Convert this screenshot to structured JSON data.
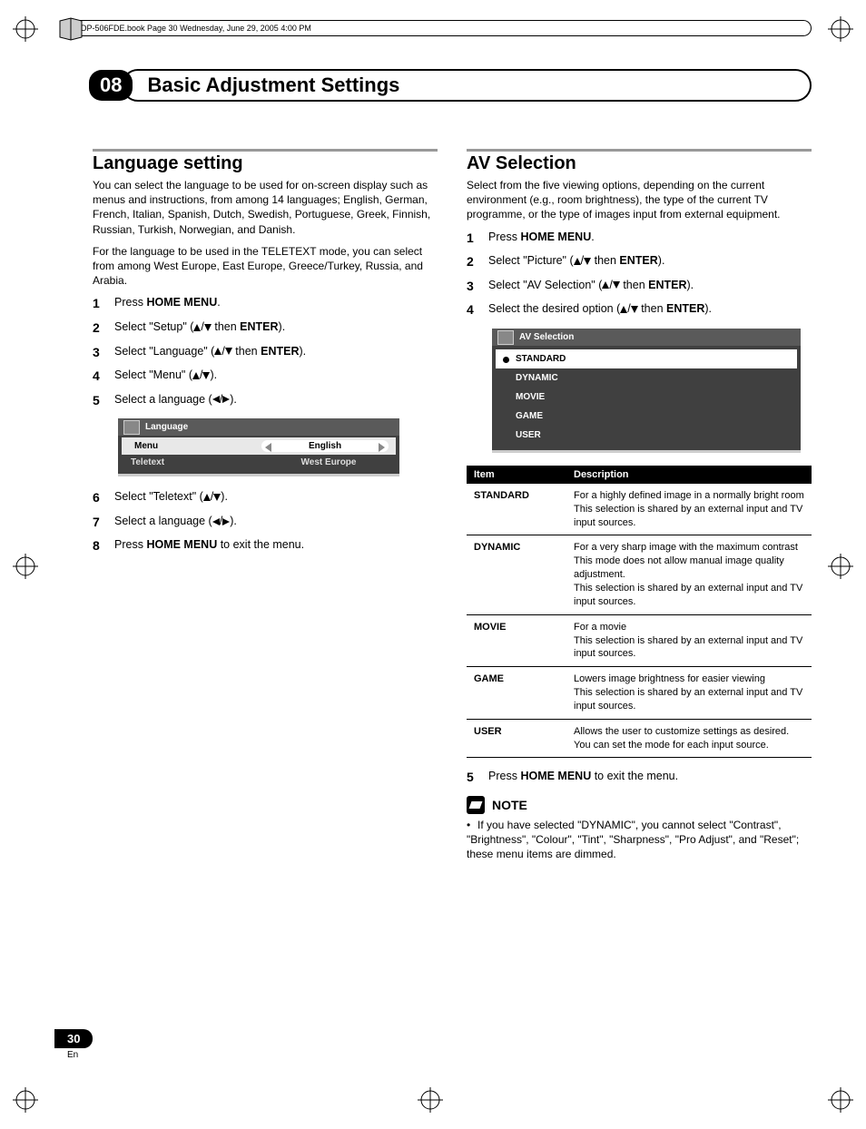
{
  "topbar": "PDP-506FDE.book  Page 30  Wednesday, June 29, 2005  4:00 PM",
  "chapter": {
    "num": "08",
    "title": "Basic Adjustment Settings"
  },
  "left": {
    "title": "Language setting",
    "intro1": "You can select the language to be used for on-screen display such as menus and instructions, from among 14 languages; English, German, French, Italian, Spanish, Dutch, Swedish, Portuguese, Greek, Finnish, Russian, Turkish, Norwegian, and Danish.",
    "intro2": "For the language to be used in the TELETEXT mode, you can select from among West Europe, East Europe, Greece/Turkey, Russia, and Arabia.",
    "steps": [
      {
        "n": "1",
        "pre": "Press ",
        "b": "HOME MENU",
        "post": "."
      },
      {
        "n": "2",
        "pre": "Select \"Setup\" (",
        "arrows": "ud",
        "mid": " then ",
        "b": "ENTER",
        "post": ")."
      },
      {
        "n": "3",
        "pre": "Select \"Language\" (",
        "arrows": "ud",
        "mid": " then ",
        "b": "ENTER",
        "post": ")."
      },
      {
        "n": "4",
        "pre": "Select \"Menu\" (",
        "arrows": "ud",
        "post": ")."
      },
      {
        "n": "5",
        "pre": "Select a language (",
        "arrows": "lr",
        "post": ")."
      }
    ],
    "osd": {
      "title": "Language",
      "rows": [
        {
          "label": "Menu",
          "value": "English",
          "selected": true
        },
        {
          "label": "Teletext",
          "value": "West Europe",
          "selected": false
        }
      ]
    },
    "steps2": [
      {
        "n": "6",
        "pre": "Select \"Teletext\" (",
        "arrows": "ud",
        "post": ")."
      },
      {
        "n": "7",
        "pre": "Select a language (",
        "arrows": "lr",
        "post": ")."
      },
      {
        "n": "8",
        "pre": "Press ",
        "b": "HOME MENU",
        "post": " to exit the menu."
      }
    ]
  },
  "right": {
    "title": "AV Selection",
    "intro": "Select from the five viewing options, depending on the current environment (e.g., room brightness), the type of the current TV programme, or the type of images input from external equipment.",
    "steps": [
      {
        "n": "1",
        "pre": "Press ",
        "b": "HOME MENU",
        "post": "."
      },
      {
        "n": "2",
        "pre": "Select \"Picture\" (",
        "arrows": "ud",
        "mid": " then ",
        "b": "ENTER",
        "post": ")."
      },
      {
        "n": "3",
        "pre": "Select \"AV Selection\" (",
        "arrows": "ud",
        "mid": " then ",
        "b": "ENTER",
        "post": ")."
      },
      {
        "n": "4",
        "pre": "Select the desired option (",
        "arrows": "ud",
        "mid": " then ",
        "b": "ENTER",
        "post": ")."
      }
    ],
    "osd": {
      "title": "AV Selection",
      "items": [
        "STANDARD",
        "DYNAMIC",
        "MOVIE",
        "GAME",
        "USER"
      ],
      "selected": 0
    },
    "table": {
      "head": [
        "Item",
        "Description"
      ],
      "rows": [
        {
          "item": "STANDARD",
          "desc": "For a highly defined image in a normally bright room\nThis selection is shared by an external input and TV input sources."
        },
        {
          "item": "DYNAMIC",
          "desc": "For a very sharp image with the maximum contrast\nThis mode does not allow manual image quality adjustment.\nThis selection is shared by an external input and TV input sources."
        },
        {
          "item": "MOVIE",
          "desc": "For a movie\nThis selection is shared by an external input and TV input sources."
        },
        {
          "item": "GAME",
          "desc": "Lowers image brightness for easier viewing\nThis selection is shared by an external input and TV input sources."
        },
        {
          "item": "USER",
          "desc": "Allows the user to customize settings as desired. You can set the mode for each input source."
        }
      ]
    },
    "step5": {
      "n": "5",
      "pre": "Press ",
      "b": "HOME MENU",
      "post": " to exit the menu."
    },
    "note": {
      "title": "NOTE",
      "body": "If you have selected \"DYNAMIC\", you cannot select \"Contrast\", \"Brightness\", \"Colour\", \"Tint\", \"Sharpness\", \"Pro Adjust\", and \"Reset\"; these menu items are dimmed."
    }
  },
  "footer": {
    "page": "30",
    "lang": "En"
  }
}
